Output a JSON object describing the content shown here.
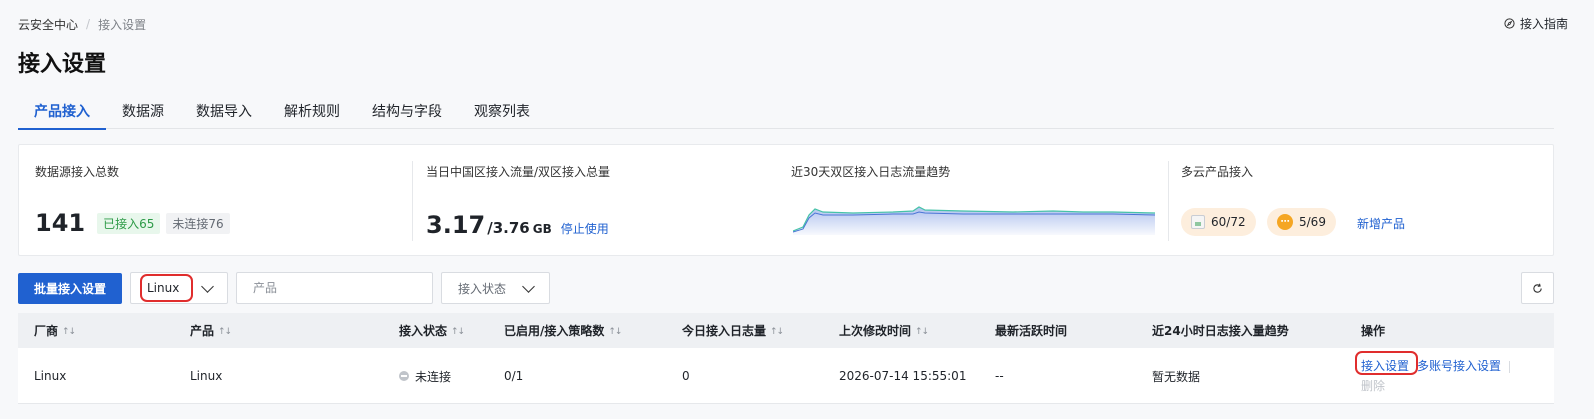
{
  "breadcrumb": {
    "root": "云安全中心",
    "separator": "/",
    "current": "接入设置"
  },
  "guide_link": "接入指南",
  "page_title": "接入设置",
  "tabs": [
    {
      "label": "产品接入",
      "active": true
    },
    {
      "label": "数据源",
      "active": false
    },
    {
      "label": "数据导入",
      "active": false
    },
    {
      "label": "解析规则",
      "active": false
    },
    {
      "label": "结构与字段",
      "active": false
    },
    {
      "label": "观察列表",
      "active": false
    }
  ],
  "stats": {
    "total": {
      "label": "数据源接入总数",
      "value": "141",
      "connected": "已接入65",
      "unconnected": "未连接76"
    },
    "traffic": {
      "label": "当日中国区接入流量/双区接入总量",
      "value": "3.17",
      "total": "/3.76",
      "unit": "GB",
      "action": "停止使用"
    },
    "trend": {
      "label": "近30天双区接入日志流量趋势"
    },
    "multicloud": {
      "label": "多云产品接入",
      "pill1": "60/72",
      "pill2": "5/69",
      "add": "新增产品"
    }
  },
  "toolbar": {
    "batch_button": "批量接入设置",
    "vendor_select": "Linux",
    "product_placeholder": "产品",
    "status_select": "接入状态"
  },
  "table": {
    "headers": [
      "厂商",
      "产品",
      "接入状态",
      "已启用/接入策略数",
      "今日接入日志量",
      "上次修改时间",
      "最新活跃时间",
      "近24小时日志接入量趋势",
      "操作"
    ],
    "rows": [
      {
        "vendor": "Linux",
        "product": "Linux",
        "status": "未连接",
        "policies": "0/1",
        "today_logs": "0",
        "modified": "2026-07-14 15:55:01",
        "last_active": "--",
        "trend": "暂无数据",
        "actions": {
          "settings": "接入设置",
          "multi_account": "多账号接入设置",
          "delete": "删除"
        }
      }
    ]
  },
  "colors": {
    "primary": "#2061d0",
    "highlight_ring": "#e02d2d",
    "connected": "#2e9b48"
  }
}
